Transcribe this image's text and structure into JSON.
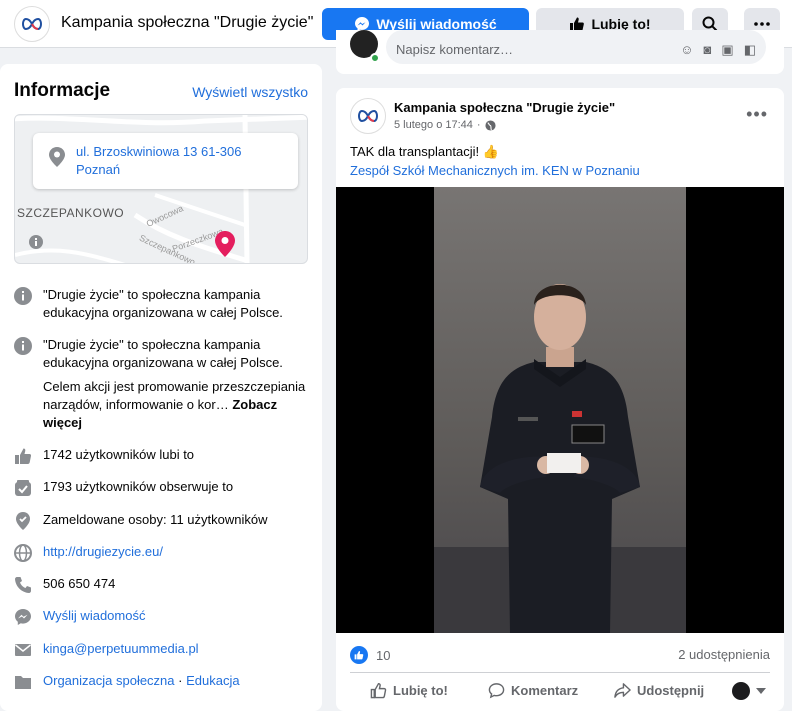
{
  "header": {
    "page_title": "Kampania społeczna \"Drugie życie\"",
    "send_message": "Wyślij wiadomość",
    "like": "Lubię to!"
  },
  "info": {
    "title": "Informacje",
    "see_all": "Wyświetl wszystko",
    "map": {
      "address_line1": "ul. Brzoskwiniowa 13 61-306",
      "address_line2": "Poznań",
      "district": "SZCZEPANKOWO",
      "street_labels": [
        "Owocowa",
        "Szczepankowo",
        "Porzeczkowa"
      ]
    },
    "about_1": "\"Drugie życie\" to społeczna kampania edukacyjna organizowana w całej Polsce.",
    "about_2": "\"Drugie życie\" to społeczna kampania edukacyjna organizowana w całej Polsce.",
    "about_3": "Celem akcji jest promowanie przeszczepiania narządów, informowanie o kor…",
    "see_more": "Zobacz więcej",
    "likes": "1742 użytkowników lubi to",
    "followers": "1793 użytkowników obserwuje to",
    "checkins": "Zameldowane osoby: 11 użytkowników",
    "website": "http://drugiezycie.eu/",
    "phone": "506 650 474",
    "messenger": "Wyślij wiadomość",
    "email": "kinga@perpetuummedia.pl",
    "category_1": "Organizacja społeczna",
    "category_sep": " · ",
    "category_2": "Edukacja"
  },
  "composer": {
    "placeholder": "Napisz komentarz…"
  },
  "post": {
    "author": "Kampania społeczna \"Drugie życie\"",
    "date": "5 lutego o 17:44",
    "dot": "·",
    "text": "TAK dla transplantacji! 👍",
    "location": "Zespół Szkół Mechanicznych im. KEN w Poznaniu",
    "like_count": "10",
    "shares": "2 udostępnienia",
    "action_like": "Lubię to!",
    "action_comment": "Komentarz",
    "action_share": "Udostępnij"
  },
  "colors": {
    "accent": "#1877f2",
    "link": "#216fdb",
    "pin": "#e41e5e"
  }
}
